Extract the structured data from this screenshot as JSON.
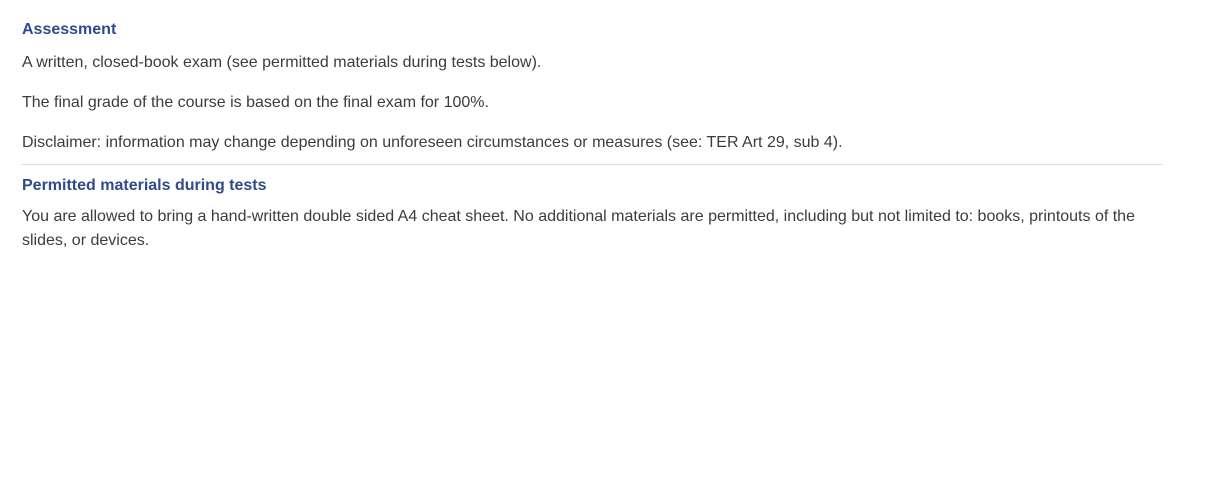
{
  "assessment": {
    "heading": "Assessment",
    "paragraphs": [
      "A written, closed-book exam (see permitted materials during tests below).",
      "The final grade of the course is based on the final exam for 100%.",
      "Disclaimer: information may change depending on unforeseen circumstances or measures (see: TER Art 29, sub 4)."
    ]
  },
  "materials": {
    "heading": "Permitted materials during tests",
    "paragraph": "You are allowed to bring a hand-written double sided A4 cheat sheet. No additional materials are permitted, including but not limited to: books, printouts of the slides, or devices."
  },
  "colors": {
    "heading": "#2f4b8a",
    "text": "#3c3c3c",
    "divider": "#dcdcdc"
  }
}
